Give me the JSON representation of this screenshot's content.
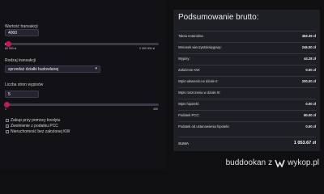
{
  "form": {
    "value_label": "Wartość transakcji",
    "value_input": "4000",
    "value_slider": {
      "min_label": "60 000 zł",
      "max_label": "2 000 000 zł",
      "fraction": 0.02
    },
    "type_label": "Rodzaj transakcji",
    "type_selected": "sprzedaż działki budowlanej",
    "pages_label": "Liczba stron wypisów",
    "pages_input": "5",
    "pages_slider": {
      "min_label": "1",
      "max_label": "400",
      "fraction": 0.01
    },
    "checkboxes": [
      {
        "label": "Zakup przy pomocy kredytu",
        "checked": false
      },
      {
        "label": "Zwolnienie z podatku PCC",
        "checked": false
      },
      {
        "label": "Nieruchomość bez założonej KW",
        "checked": false
      }
    ]
  },
  "summary": {
    "title": "Podsumowanie brutto:",
    "rows": [
      {
        "label": "Taksa notarialna:",
        "value": "483.39 zł"
      },
      {
        "label": "Wniosek wieczystoksięgowy:",
        "value": "246.00 zł"
      },
      {
        "label": "Wypisy:",
        "value": "44.28 zł"
      },
      {
        "label": "Założenie KW:",
        "value": "0.00 zł"
      },
      {
        "label": "Wpis własności w dziale II:",
        "value": "200.00 zł"
      },
      {
        "label": "Wpis roszczenia w dziale III:",
        "value": ""
      },
      {
        "label": "Wpis hipoteki:",
        "value": "0.00 zł"
      },
      {
        "label": "Podatek PCC:",
        "value": "80.00 zł"
      },
      {
        "label": "Podatek od ustanowienia hipoteki:",
        "value": "0.00 zł"
      }
    ],
    "total_label": "SUMA",
    "total_value": "1 053.67 zł"
  },
  "watermark": {
    "user": "buddookan",
    "separator": "z",
    "site": "wykop.pl",
    "icon": "wykop-logo-icon"
  },
  "colors": {
    "accent": "#c2185b",
    "slider_fill": "#d97aa0"
  }
}
